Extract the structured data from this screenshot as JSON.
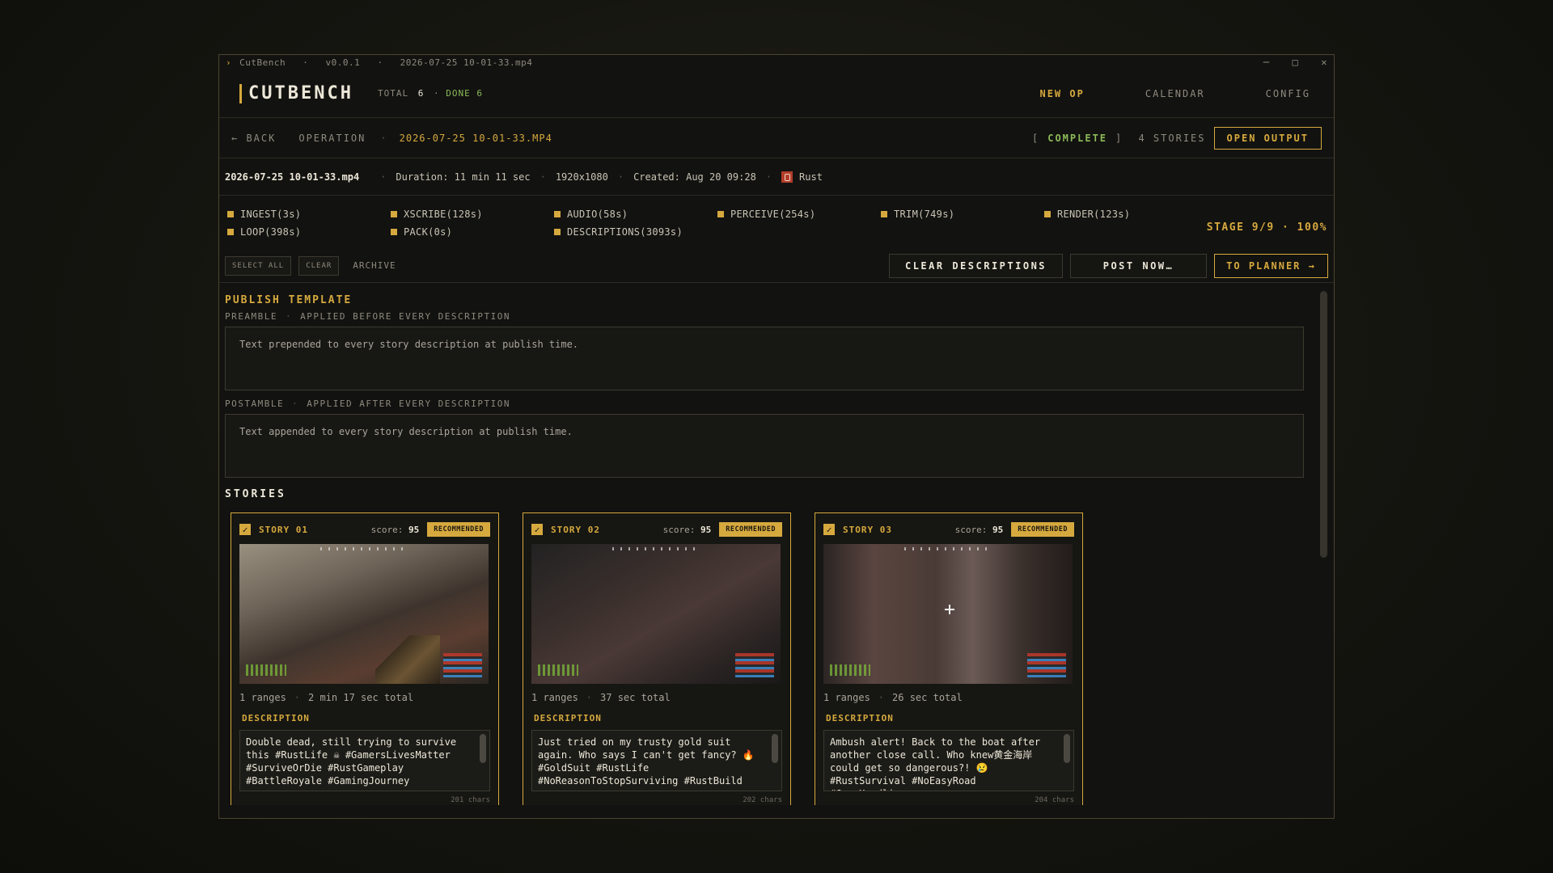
{
  "titlebar": {
    "app": "CutBench",
    "version": "v0.0.1",
    "file": "2026-07-25 10-01-33.mp4",
    "minimize": "─",
    "maximize": "□",
    "close": "✕"
  },
  "header": {
    "brand": "CUTBENCH",
    "total_label": "TOTAL",
    "total_value": "6",
    "done_label": "DONE 6",
    "nav": [
      "NEW OP",
      "CALENDAR",
      "CONFIG"
    ]
  },
  "operation": {
    "back": "← BACK",
    "crumb": "OPERATION",
    "file": "2026-07-25 10-01-33.MP4",
    "status_open": "[",
    "status_value": "COMPLETE",
    "status_close": "]",
    "stories_count": "4 STORIES",
    "open_output": "OPEN OUTPUT"
  },
  "meta": {
    "filename": "2026-07-25 10-01-33.mp4",
    "duration": "Duration: 11 min 11 sec",
    "resolution": "1920x1080",
    "created": "Created: Aug 20 09:28",
    "game": "Rust"
  },
  "stages": {
    "items": [
      "INGEST(3s)",
      "XSCRIBE(128s)",
      "AUDIO(58s)",
      "PERCEIVE(254s)",
      "TRIM(749s)",
      "RENDER(123s)",
      "LOOP(398s)",
      "PACK(0s)",
      "DESCRIPTIONS(3093s)"
    ],
    "progress": "STAGE 9/9 · 100%"
  },
  "actions": {
    "select_all": "SELECT ALL",
    "clear": "CLEAR",
    "archive": "ARCHIVE",
    "clear_descriptions": "CLEAR DESCRIPTIONS",
    "post_now": "POST NOW…",
    "to_planner": "TO PLANNER →"
  },
  "publish": {
    "title": "PUBLISH TEMPLATE",
    "preamble_label": "PREAMBLE",
    "preamble_hint": "APPLIED BEFORE EVERY DESCRIPTION",
    "preamble_placeholder": "Text prepended to every story description at publish time.",
    "postamble_label": "POSTAMBLE",
    "postamble_hint": "APPLIED AFTER EVERY DESCRIPTION",
    "postamble_placeholder": "Text appended to every story description at publish time."
  },
  "stories": {
    "title": "STORIES",
    "items": [
      {
        "name": "STORY 01",
        "score_label": "score:",
        "score": "95",
        "badge": "RECOMMENDED",
        "ranges": "1 ranges",
        "total": "2 min 17 sec total",
        "desc_label": "DESCRIPTION",
        "description": "Double dead, still trying to survive this #RustLife ☠ #GamersLivesMatter #SurviveOrDie #RustGameplay #BattleRoyale #GamingJourney",
        "chars": "201 chars"
      },
      {
        "name": "STORY 02",
        "score_label": "score:",
        "score": "95",
        "badge": "RECOMMENDED",
        "ranges": "1 ranges",
        "total": "37 sec total",
        "desc_label": "DESCRIPTION",
        "description": "Just tried on my trusty gold suit again. Who says I can't get fancy? 🔥 #GoldSuit #RustLife #NoReasonToStopSurviving #RustBuild",
        "chars": "202 chars"
      },
      {
        "name": "STORY 03",
        "score_label": "score:",
        "score": "95",
        "badge": "RECOMMENDED",
        "ranges": "1 ranges",
        "total": "26 sec total",
        "desc_label": "DESCRIPTION",
        "description": "Ambush alert! Back to the boat after another close call. Who knew黄金海岸 could get so dangerous?! 😢 #RustSurvival #NoEasyRoad #GameHeadlines",
        "chars": "204 chars"
      }
    ]
  },
  "colors": {
    "accent": "#d6a93e",
    "success": "#8cba58",
    "background": "#121210"
  }
}
